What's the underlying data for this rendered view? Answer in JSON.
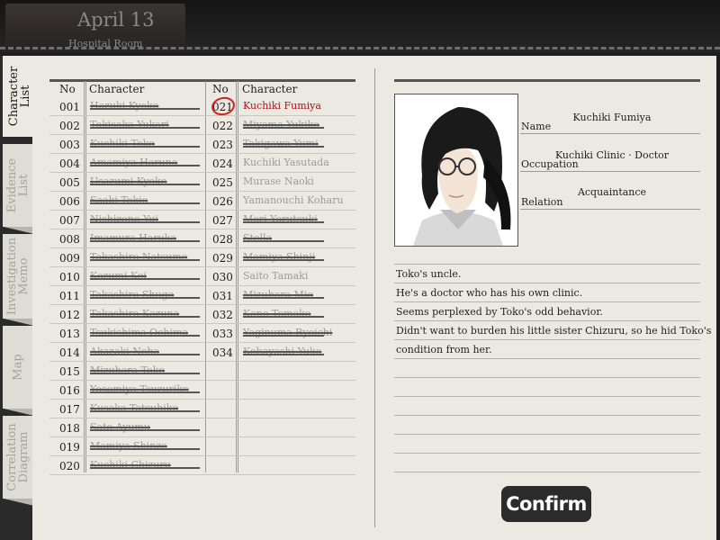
{
  "header": {
    "date": "April 13",
    "location": "Hospital Room"
  },
  "tabs": [
    {
      "label": "Character List",
      "active": true
    },
    {
      "label": "Evidence List",
      "active": false
    },
    {
      "label": "Investigation Memo",
      "active": false
    },
    {
      "label": "Map",
      "active": false
    },
    {
      "label": "Correlation Diagram",
      "active": false
    }
  ],
  "list": {
    "col_no": "No",
    "col_character": "Character",
    "left": [
      {
        "no": "001",
        "name": "Hazuki Kyoko",
        "struck": true
      },
      {
        "no": "002",
        "name": "Tokisaka Yukari",
        "struck": true
      },
      {
        "no": "003",
        "name": "Kuchiki Toko",
        "struck": true
      },
      {
        "no": "004",
        "name": "Amamiya Haruna",
        "struck": true
      },
      {
        "no": "005",
        "name": "Usazumi Kyoko",
        "struck": true
      },
      {
        "no": "006",
        "name": "Saaki Tokio",
        "struck": true
      },
      {
        "no": "007",
        "name": "Nishizono Yui",
        "struck": true
      },
      {
        "no": "008",
        "name": "Imamura Haruka",
        "struck": true
      },
      {
        "no": "009",
        "name": "Takashiro Natsume",
        "struck": true
      },
      {
        "no": "010",
        "name": "Kozumi Kei",
        "struck": true
      },
      {
        "no": "011",
        "name": "Takashiro Shugo",
        "struck": true
      },
      {
        "no": "012",
        "name": "Takashiro Kazuna",
        "struck": true
      },
      {
        "no": "013",
        "name": "Tsukishima Ochima",
        "struck": true
      },
      {
        "no": "014",
        "name": "Akazaki Neha",
        "struck": true
      },
      {
        "no": "015",
        "name": "Mizuhara Toko",
        "struck": true
      },
      {
        "no": "016",
        "name": "Yosomiya Tsuzuriko",
        "struck": true
      },
      {
        "no": "017",
        "name": "Kusaka Tatsuhiko",
        "struck": true
      },
      {
        "no": "018",
        "name": "Sato Ayumu",
        "struck": true
      },
      {
        "no": "019",
        "name": "Mamiya Shinzo",
        "struck": true
      },
      {
        "no": "020",
        "name": "Kuchiki Chizuru",
        "struck": true
      }
    ],
    "right": [
      {
        "no": "021",
        "name": "Kuchiki Fumiya",
        "struck": false,
        "selected": true
      },
      {
        "no": "022",
        "name": "Miyama Yukiko",
        "struck": true
      },
      {
        "no": "023",
        "name": "Takigawa Yumi",
        "struck": true
      },
      {
        "no": "024",
        "name": "Kuchiki Yasutada",
        "struck": false
      },
      {
        "no": "025",
        "name": "Murase Naoki",
        "struck": false
      },
      {
        "no": "026",
        "name": "Yamanouchi Koharu",
        "struck": false
      },
      {
        "no": "027",
        "name": "Mori Yorutsuki",
        "struck": true
      },
      {
        "no": "028",
        "name": "Stella",
        "struck": true
      },
      {
        "no": "029",
        "name": "Mamiya Shinji",
        "struck": true
      },
      {
        "no": "030",
        "name": "Saito Tamaki",
        "struck": false
      },
      {
        "no": "031",
        "name": "Mizuhara Mio",
        "struck": true
      },
      {
        "no": "032",
        "name": "Kano Tomoko",
        "struck": true
      },
      {
        "no": "033",
        "name": "Yaginuma Ryoichi",
        "struck": true
      },
      {
        "no": "034",
        "name": "Kobayashi Yuko",
        "struck": true
      }
    ]
  },
  "detail": {
    "name_label": "Name",
    "name_value": "Kuchiki Fumiya",
    "occupation_label": "Occupation",
    "occupation_value": "Kuchiki Clinic · Doctor",
    "relation_label": "Relation",
    "relation_value": "Acquaintance",
    "notes": [
      "Toko's uncle.",
      "He's a doctor who has his own clinic.",
      "Seems perplexed by Toko's odd behavior.",
      "Didn't want to burden his little sister Chizuru, so he hid Toko's",
      "condition from her."
    ]
  },
  "confirm_label": "Confirm"
}
